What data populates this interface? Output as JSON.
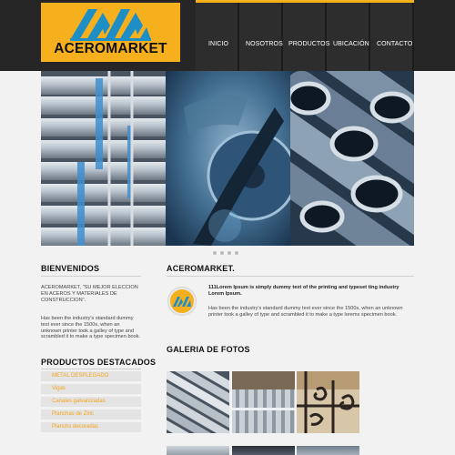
{
  "header": {
    "brand": "ACEROMARKET",
    "accent_color": "#f6b01e",
    "nav": [
      "INICIO",
      "NOSOTROS",
      "PRODUCTOS",
      "UBICACIÓN",
      "CONTACTO"
    ]
  },
  "hero": {
    "slides": [
      "galvanized-pipes-stack",
      "pipe-cutting-saw",
      "steel-tube-ends"
    ],
    "dot_count": 4
  },
  "left": {
    "welcome_title": "BIENVENIDOS",
    "welcome_quote": "ACEROMARKET, \"SU MEJOR ELECCION EN ACEROS Y MATERIALES DE CONSTRUCCION\".",
    "welcome_body": "Has been the industry's standard dummy text ever since the 1500s, when an unknown printer took a galley of type and scrambled it to make a type specimen book.",
    "products_title": "PRODUCTOS DESTACADOS",
    "products": [
      "METAL DESPLEGADO",
      "Vigas",
      "Canales galvanizadas",
      "Planchas de Zinc",
      "Planchs decoradas"
    ]
  },
  "main": {
    "title": "ACEROMARKET.",
    "intro_bold": "111Lorem Ipsum is simply dummy text of the printing and typeset ting industry Lorem Ipsum.",
    "intro_body": "Has been the industry's standard dummy text ever since the 1500s, when an unknown printer took a galley of type and scrambled it to make a type lorems specimen book.",
    "gallery_title": "GALERIA DE FOTOS",
    "gallery": [
      "steel-pipes-photo",
      "corrugated-sheets-photo",
      "wrought-iron-rail-photo"
    ]
  }
}
